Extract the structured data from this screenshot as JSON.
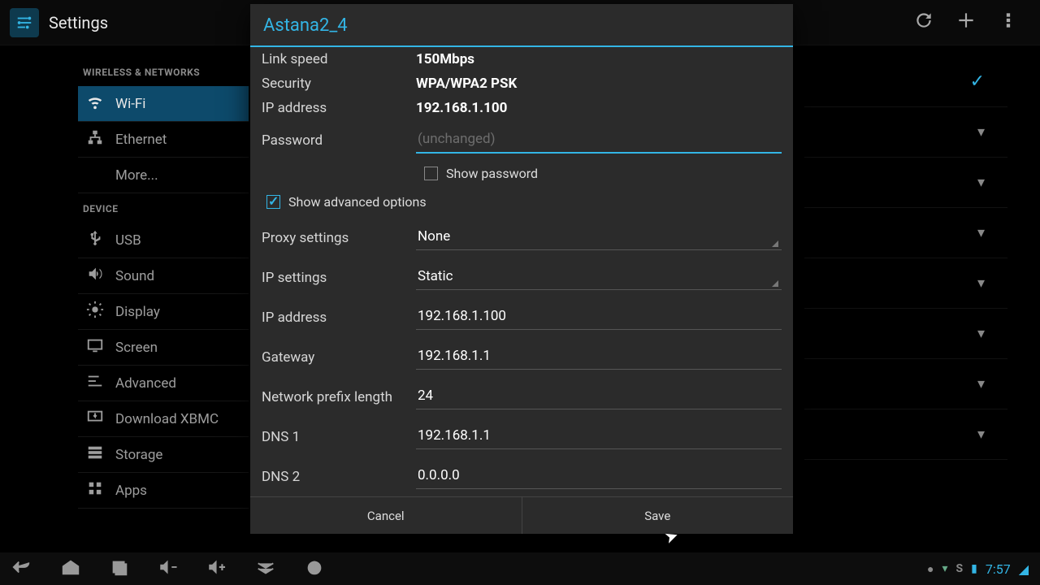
{
  "app": {
    "title": "Settings"
  },
  "topbar_actions": {
    "refresh": "refresh",
    "add": "add",
    "overflow": "menu"
  },
  "sidebar": {
    "hdr_wireless": "WIRELESS & NETWORKS",
    "hdr_device": "DEVICE",
    "items": [
      {
        "label": "Wi-Fi"
      },
      {
        "label": "Ethernet"
      },
      {
        "label": "More..."
      },
      {
        "label": "USB"
      },
      {
        "label": "Sound"
      },
      {
        "label": "Display"
      },
      {
        "label": "Screen"
      },
      {
        "label": "Advanced"
      },
      {
        "label": "Download XBMC"
      },
      {
        "label": "Storage"
      },
      {
        "label": "Apps"
      }
    ]
  },
  "dialog": {
    "title": "Astana2_4",
    "info": {
      "link_speed_lbl": "Link speed",
      "link_speed_val": "150Mbps",
      "security_lbl": "Security",
      "security_val": "WPA/WPA2 PSK",
      "ip_info_lbl": "IP address",
      "ip_info_val": "192.168.1.100"
    },
    "password_lbl": "Password",
    "password_placeholder": "(unchanged)",
    "show_password_lbl": "Show password",
    "show_advanced_lbl": "Show advanced options",
    "proxy_lbl": "Proxy settings",
    "proxy_val": "None",
    "ipset_lbl": "IP settings",
    "ipset_val": "Static",
    "ip_lbl": "IP address",
    "ip_val": "192.168.1.100",
    "gw_lbl": "Gateway",
    "gw_val": "192.168.1.1",
    "prefix_lbl": "Network prefix length",
    "prefix_val": "24",
    "dns1_lbl": "DNS 1",
    "dns1_val": "192.168.1.1",
    "dns2_lbl": "DNS 2",
    "dns2_val": "0.0.0.0",
    "cancel": "Cancel",
    "save": "Save"
  },
  "navbar": {
    "clock": "7:57"
  }
}
